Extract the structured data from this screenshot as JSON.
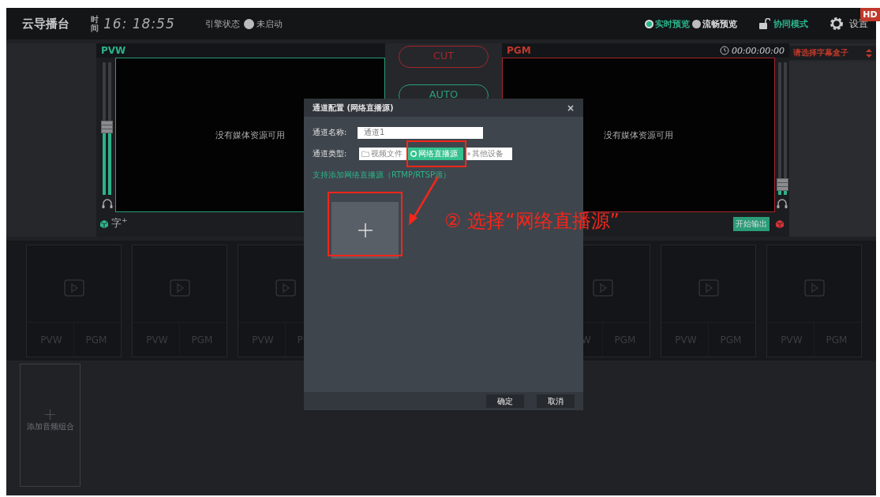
{
  "top_bar": {
    "logo": "云导播台",
    "clock_label": "时间",
    "clock": "16: 18:55",
    "engine_label": "引擎状态",
    "engine_on": false,
    "engine_status": "未启动",
    "preview_modes": [
      {
        "label": "实时预览",
        "selected": true
      },
      {
        "label": "流畅预览",
        "selected": false
      }
    ],
    "collab": "协同模式",
    "settings": "设置",
    "badge": "HD"
  },
  "pvw": {
    "title": "PVW",
    "message": "没有媒体资源可用",
    "level": 0.51,
    "overlay_label": "字$^{+}$"
  },
  "switcher": {
    "cut": "CUT",
    "auto": "AUTO"
  },
  "pgm": {
    "title": "PGM",
    "timecode": "00:00:00:00",
    "message": "没有媒体资源可用",
    "level": 0.08,
    "output_button": "开始输出"
  },
  "subtitle_select": {
    "placeholder": "请选择字幕盒子"
  },
  "channels": [
    {
      "pvw": "PVW",
      "pgm": "PGM"
    },
    {
      "pvw": "PVW",
      "pgm": "PGM"
    },
    {
      "pvw": "PVW",
      "pgm": "P"
    },
    {
      "pvw": "W",
      "pgm": "PGM"
    },
    {
      "pvw": "PVW",
      "pgm": "PGM"
    },
    {
      "pvw": "PVW",
      "pgm": "PGM"
    }
  ],
  "audio": {
    "add_label": "添加音频组合"
  },
  "dialog": {
    "title": "通道配置 (网络直播源)",
    "close": "×",
    "name_label": "通道名称:",
    "name_value": "通道1",
    "type_label": "通道类型:",
    "types": [
      {
        "label": "视频文件",
        "kind": "file",
        "selected": false
      },
      {
        "label": "网络直播源",
        "kind": "stream",
        "selected": true
      },
      {
        "label": "其他设备",
        "kind": "device",
        "selected": false
      }
    ],
    "hint": "支持添加网络直播源（RTMP/RTSP源）",
    "ok": "确定",
    "cancel": "取消"
  },
  "annotation": {
    "text": "② 选择“网络直播源”"
  }
}
